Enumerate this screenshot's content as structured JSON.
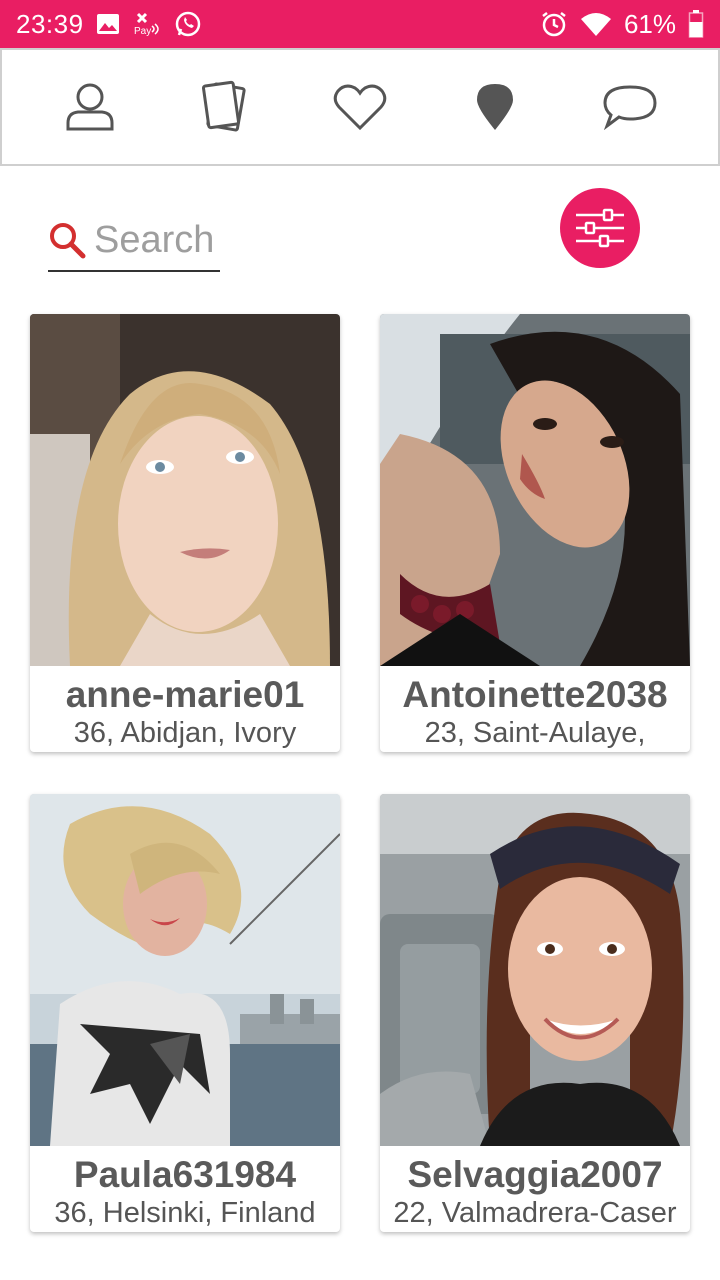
{
  "status_bar": {
    "time": "23:39",
    "battery": "61%",
    "left_icons": [
      "image-icon",
      "pay-icon",
      "whatsapp-icon"
    ],
    "right_icons": [
      "alarm-icon",
      "wifi-icon",
      "battery-icon"
    ]
  },
  "nav": {
    "items": [
      {
        "icon": "profile-icon"
      },
      {
        "icon": "cards-icon"
      },
      {
        "icon": "heart-icon"
      },
      {
        "icon": "location-pin-icon"
      },
      {
        "icon": "chat-icon"
      }
    ]
  },
  "search": {
    "placeholder": "Search",
    "value": ""
  },
  "filter": {
    "icon": "sliders-icon"
  },
  "colors": {
    "accent": "#E91E63",
    "text_dark": "#5a5a5a",
    "search_icon": "#D32F2F"
  },
  "profiles": [
    {
      "username": "anne-marie01",
      "location": "36, Abidjan, Ivory"
    },
    {
      "username": "Antoinette2038",
      "location": "23, Saint-Aulaye,"
    },
    {
      "username": "Paula631984",
      "location": "36, Helsinki, Finland"
    },
    {
      "username": "Selvaggia2007",
      "location": "22, Valmadrera-Caser"
    }
  ]
}
